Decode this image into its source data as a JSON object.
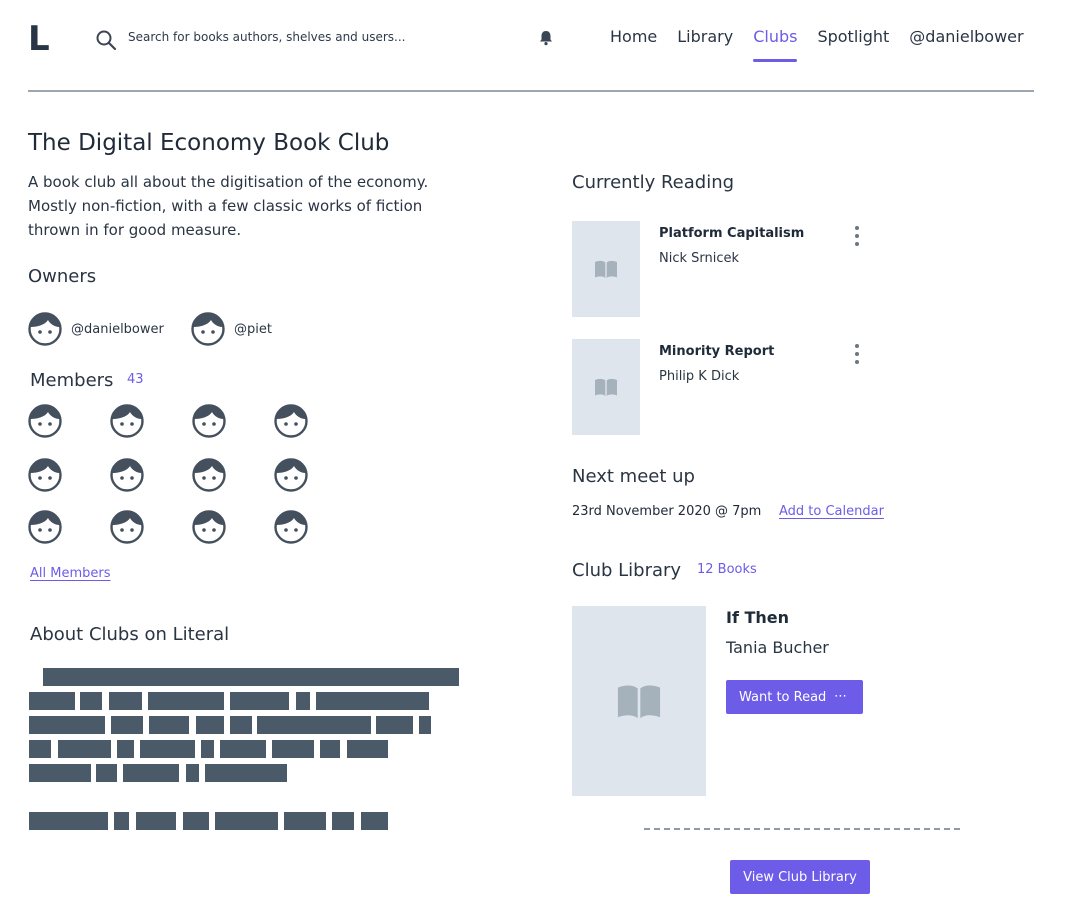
{
  "header": {
    "logo": "L",
    "search_placeholder": "Search for books authors, shelves and users...",
    "nav": [
      {
        "label": "Home"
      },
      {
        "label": "Library"
      },
      {
        "label": "Clubs",
        "active": true
      },
      {
        "label": "Spotlight"
      },
      {
        "label": "@danielbower"
      }
    ]
  },
  "club": {
    "title": "The Digital Economy Book Club",
    "description": "A book club all about the digitisation of the economy. Mostly non-fiction, with a few classic works of fiction thrown in for good measure."
  },
  "owners": {
    "title": "Owners",
    "items": [
      {
        "handle": "@danielbower",
        "icon": "face-avatar-icon"
      },
      {
        "handle": "@piet",
        "icon": "face-avatar-icon"
      }
    ]
  },
  "members": {
    "title": "Members",
    "count": "43",
    "visible_avatars": 12,
    "all_link": "All Members"
  },
  "about": {
    "title": "About Clubs on Literal"
  },
  "currently_reading": {
    "title": "Currently Reading",
    "books": [
      {
        "title": "Platform Capitalism",
        "author": "Nick Srnicek"
      },
      {
        "title": "Minority Report",
        "author": "Philip K Dick"
      }
    ]
  },
  "meetup": {
    "title": "Next meet up",
    "date": "23rd November 2020 @ 7pm",
    "add_calendar": "Add to Calendar"
  },
  "library": {
    "title": "Club Library",
    "count": "12 Books",
    "featured": {
      "title": "If Then",
      "author": "Tania Bucher"
    },
    "want_label": "Want to Read",
    "want_more": "⋯",
    "view_label": "View Club Library"
  },
  "colors": {
    "accent": "#6c5ce7",
    "text": "#202b39",
    "placeholder_bg": "#dfe5ec",
    "redacted": "#4a5a68",
    "avatar": "#44505d"
  }
}
